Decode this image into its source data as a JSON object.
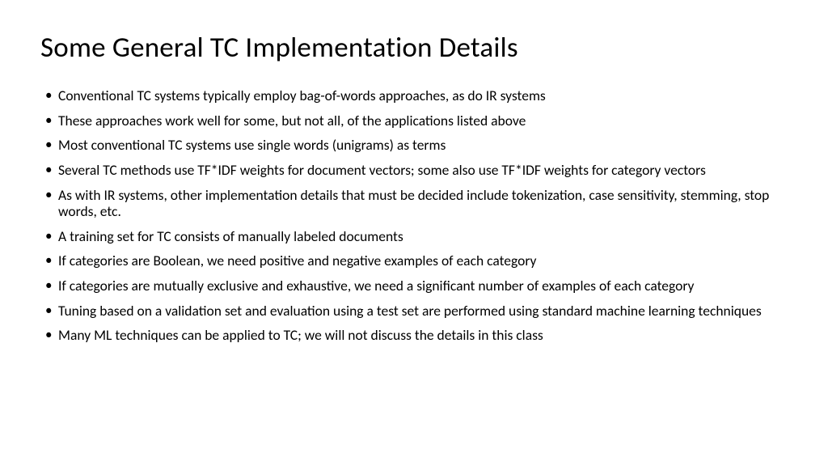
{
  "slide": {
    "title": "Some General TC Implementation Details",
    "bullets": [
      "Conventional TC systems typically employ bag-of-words approaches, as do IR systems",
      "These approaches work well for some, but not all, of the applications listed above",
      "Most conventional TC systems use single words (unigrams) as terms",
      "Several TC methods use TF*IDF weights for document vectors; some also use TF*IDF weights for category vectors",
      "As with IR systems, other implementation details that must be decided include tokenization, case sensitivity, stemming, stop words, etc.",
      "A training set for TC consists of manually labeled documents",
      "If categories are Boolean, we need positive and negative examples of each category",
      "If categories are mutually exclusive and exhaustive, we need a significant number of examples of each category",
      "Tuning based on a validation set and evaluation using a test set are performed using standard machine learning techniques",
      "Many ML techniques can be applied to TC; we will not discuss the details in this class"
    ]
  }
}
